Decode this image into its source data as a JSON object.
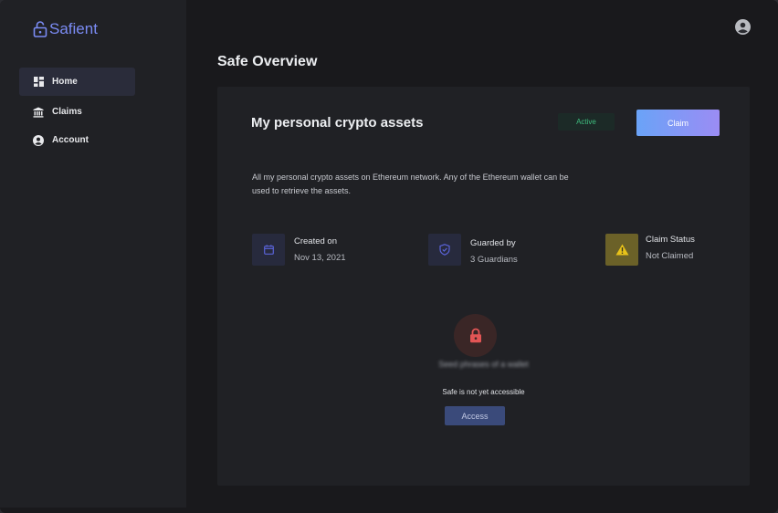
{
  "app": {
    "brand": "Safient"
  },
  "sidebar": {
    "items": [
      {
        "label": "Home",
        "icon": "dashboard-icon",
        "active": true
      },
      {
        "label": "Claims",
        "icon": "bank-icon",
        "active": false
      },
      {
        "label": "Account",
        "icon": "user-circle-icon",
        "active": false
      }
    ]
  },
  "header": {
    "avatar_icon": "user-circle-icon"
  },
  "main": {
    "title": "Safe Overview",
    "safe": {
      "name": "My personal crypto assets",
      "status_badge": "Active",
      "claim_label": "Claim",
      "description": "All my personal crypto assets on Ethereum network. Any of the Ethereum wallet can be used to retrieve the assets.",
      "stats": [
        {
          "label": "Created on",
          "value": "Nov 13, 2021",
          "icon": "calendar-icon"
        },
        {
          "label": "Guarded by",
          "value": "3 Guardians",
          "icon": "shield-check-icon"
        },
        {
          "label": "Claim Status",
          "value": "Not Claimed",
          "icon": "warning-icon"
        }
      ],
      "hidden_content": "Seed phrases of a wallet",
      "access_note": "Safe is not yet accessible",
      "access_label": "Access"
    }
  },
  "colors": {
    "accent": "#7b8cf5",
    "active_badge": "#3fbf7f",
    "warning": "#e8c21a",
    "lock": "#e25555"
  }
}
